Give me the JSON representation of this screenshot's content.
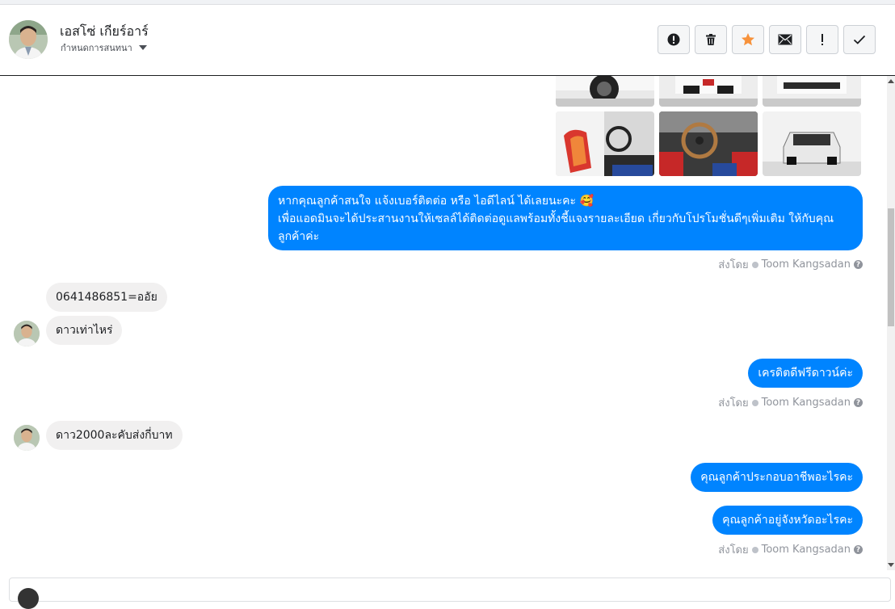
{
  "header": {
    "contact_name": "เอสโซ่ เกียร์อาร์",
    "subtitle": "กำหนดการสนทนา",
    "actions": [
      {
        "name": "spam-button",
        "icon": "alert-circle-icon"
      },
      {
        "name": "delete-button",
        "icon": "trash-icon"
      },
      {
        "name": "star-button",
        "icon": "star-icon",
        "color": "#f7923b"
      },
      {
        "name": "mark-unread-button",
        "icon": "envelope-icon"
      },
      {
        "name": "important-button",
        "icon": "exclamation-icon"
      },
      {
        "name": "done-button",
        "icon": "check-icon"
      }
    ]
  },
  "thread": {
    "outgoing_intro": "หากคุณลูกค้าสนใจ แจ้งเบอร์ติดต่อ หรือ ไอดีไลน์ ได้เลยนะคะ 🥰\nเพื่อแอดมินจะได้ประสานงานให้เซลล์ได้ติดต่อดูแลพร้อมทั้งชี้แจงรายละเอียด เกี่ยวกับโปรโมชั่นดีๆเพิ่มเติม ให้กับคุณลูกค้าค่ะ",
    "sent_by_label": "ส่งโดย",
    "sender_name": "Toom Kangsadan",
    "incoming_1": "0641486851=ออัย",
    "incoming_2": "ดาวเท่าไหร่",
    "outgoing_2": "เครดิตดีฟรีดาวน์ค่ะ",
    "incoming_3": "ดาว2000ละคับส่งกี่บาท",
    "outgoing_3": "คุณลูกค้าประกอบอาชีพอะไรคะ",
    "outgoing_4": "คุณลูกค้าอยู่จังหวัดอะไรคะ"
  },
  "colors": {
    "accent": "#0084ff",
    "incoming_bubble": "#f1f0f0",
    "star": "#f7923b"
  }
}
